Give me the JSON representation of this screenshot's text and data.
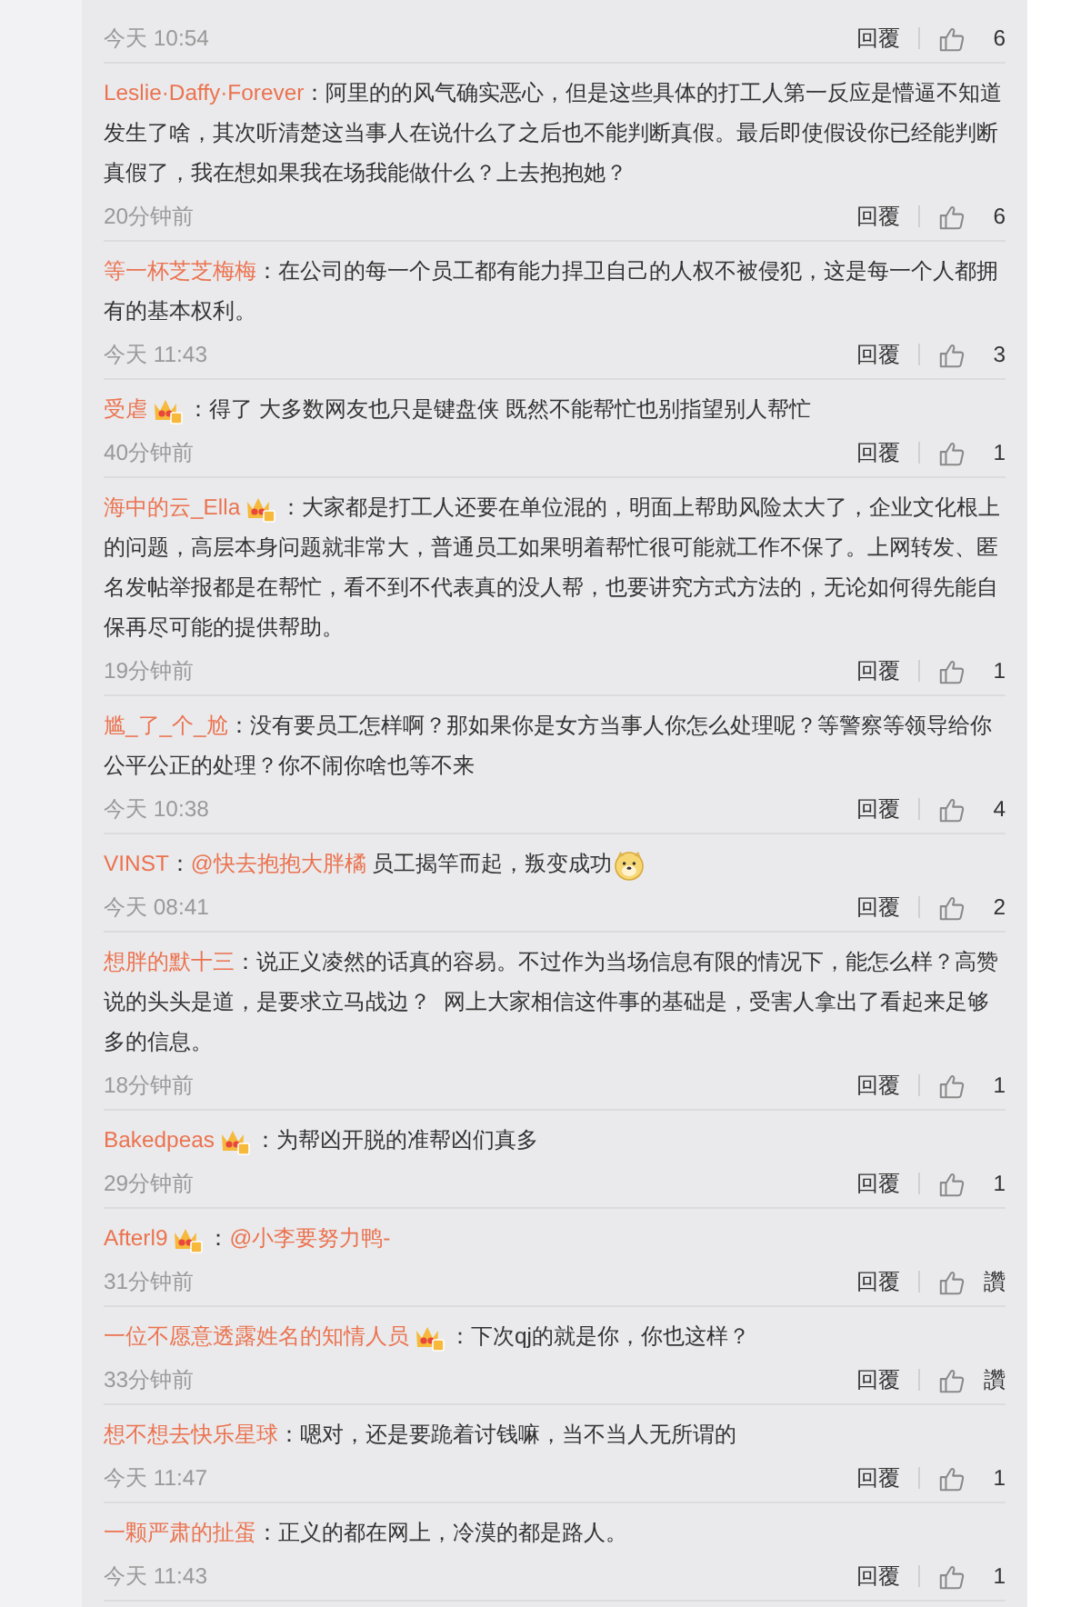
{
  "comments": [
    {
      "time": "今天 10:54",
      "reply": "回覆",
      "likes": "6"
    },
    {
      "name": "Leslie·Daffy·Forever",
      "badge": false,
      "body": [
        {
          "kind": "text",
          "text": "：阿里的的风气确实恶心，但是这些具体的打工人第一反应是懵逼不知道发生了啥，其次听清楚这当事人在说什么了之后也不能判断真假。最后即使假设你已经能判断真假了，我在想如果我在场我能做什么？上去抱抱她？"
        }
      ],
      "time": "20分钟前",
      "reply": "回覆",
      "likes": "6"
    },
    {
      "name": "等一杯芝芝梅梅",
      "badge": false,
      "body": [
        {
          "kind": "text",
          "text": "：在公司的每一个员工都有能力捍卫自己的人权不被侵犯，这是每一个人都拥有的基本权利。"
        }
      ],
      "time": "今天 11:43",
      "reply": "回覆",
      "likes": "3"
    },
    {
      "name": "受虐",
      "badge": true,
      "body": [
        {
          "kind": "text",
          "text": "：得了 大多数网友也只是键盘侠 既然不能帮忙也别指望别人帮忙"
        }
      ],
      "time": "40分钟前",
      "reply": "回覆",
      "likes": "1"
    },
    {
      "name": "海中的云_Ella",
      "badge": true,
      "body": [
        {
          "kind": "text",
          "text": "：大家都是打工人还要在单位混的，明面上帮助风险太大了，企业文化根上的问题，高层本身问题就非常大，普通员工如果明着帮忙很可能就工作不保了。上网转发、匿名发帖举报都是在帮忙，看不到不代表真的没人帮，也要讲究方式方法的，无论如何得先能自保再尽可能的提供帮助。"
        }
      ],
      "time": "19分钟前",
      "reply": "回覆",
      "likes": "1"
    },
    {
      "name": "尴_了_个_尬",
      "badge": false,
      "body": [
        {
          "kind": "text",
          "text": "：没有要员工怎样啊？那如果你是女方当事人你怎么处理呢？等警察等领导给你公平公正的处理？你不闹你啥也等不来"
        }
      ],
      "time": "今天 10:38",
      "reply": "回覆",
      "likes": "4"
    },
    {
      "name": "VINST",
      "badge": false,
      "body": [
        {
          "kind": "text",
          "text": "："
        },
        {
          "kind": "mention",
          "text": "@快去抱抱大胖橘"
        },
        {
          "kind": "text",
          "text": " 员工揭竿而起，叛变成功"
        },
        {
          "kind": "emoji"
        }
      ],
      "time": "今天 08:41",
      "reply": "回覆",
      "likes": "2"
    },
    {
      "name": "想胖的默十三",
      "badge": false,
      "body": [
        {
          "kind": "text",
          "text": "：说正义凌然的话真的容易。不过作为当场信息有限的情况下，能怎么样？高赞说的头头是道，是要求立马战边？  网上大家相信这件事的基础是，受害人拿出了看起来足够多的信息。"
        }
      ],
      "time": "18分钟前",
      "reply": "回覆",
      "likes": "1"
    },
    {
      "name": "Bakedpeas",
      "badge": true,
      "body": [
        {
          "kind": "text",
          "text": "：为帮凶开脱的准帮凶们真多"
        }
      ],
      "time": "29分钟前",
      "reply": "回覆",
      "likes": "1"
    },
    {
      "name": "Afterl9",
      "badge": true,
      "body": [
        {
          "kind": "text",
          "text": "："
        },
        {
          "kind": "mention",
          "text": "@小李要努力鸭-"
        }
      ],
      "time": "31分钟前",
      "reply": "回覆",
      "likes": "讚"
    },
    {
      "name": "一位不愿意透露姓名的知情人员",
      "badge": true,
      "body": [
        {
          "kind": "text",
          "text": "：下次qj的就是你，你也这样？"
        }
      ],
      "time": "33分钟前",
      "reply": "回覆",
      "likes": "讚"
    },
    {
      "name": "想不想去快乐星球",
      "badge": false,
      "body": [
        {
          "kind": "text",
          "text": "：嗯对，还是要跪着讨钱嘛，当不当人无所谓的"
        }
      ],
      "time": "今天 11:47",
      "reply": "回覆",
      "likes": "1"
    },
    {
      "name": "一颗严肃的扯蛋",
      "badge": false,
      "body": [
        {
          "kind": "text",
          "text": "：正义的都在网上，冷漠的都是路人。"
        }
      ],
      "time": "今天 11:43",
      "reply": "回覆",
      "likes": "1"
    }
  ]
}
